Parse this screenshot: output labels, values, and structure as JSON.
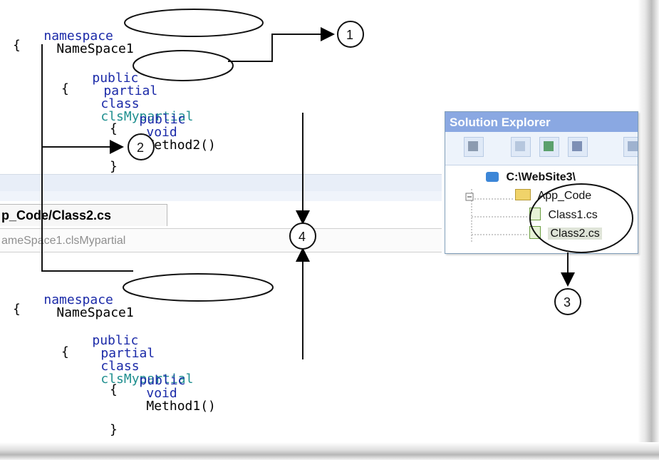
{
  "colors": {
    "keyword": "#1b2aa8",
    "class": "#1f8f8f",
    "text": "#000000",
    "ide_band": "#e8eef8",
    "panel_title": "#8aa8e2",
    "panel_border": "#7f9db9"
  },
  "code_top": {
    "line1": {
      "kw": "namespace",
      "name": "NameSpace1"
    },
    "brace_open": "{",
    "line3": {
      "kw1": "public",
      "kw2": "partial",
      "kw3": "class",
      "cls": "clsMypartial"
    },
    "brace_open2": "{",
    "line5": {
      "kw1": "public",
      "kw2": "void",
      "method": "Method2()"
    },
    "brace_open3": "{",
    "brace_close3": "}"
  },
  "tab": {
    "label": "p_Code/Class2.cs"
  },
  "nav": {
    "label": "ameSpace1.clsMypartial"
  },
  "code_bottom": {
    "line1": {
      "kw": "namespace",
      "name": "NameSpace1"
    },
    "brace_open": "{",
    "line3": {
      "kw1": "public",
      "kw2": "partial",
      "kw3": "class",
      "cls": "clsMypartial"
    },
    "brace_open2": "{",
    "line5": {
      "kw1": "public",
      "kw2": "void",
      "method": "Method1()"
    },
    "brace_open3": "{",
    "brace_close3": "}"
  },
  "solution_explorer": {
    "title": "Solution Explorer",
    "tree": [
      {
        "label": "C:\\WebSite3\\",
        "icon": "website-icon"
      },
      {
        "label": "App_Code",
        "icon": "folder-icon"
      },
      {
        "label": "Class1.cs",
        "icon": "csharp-file-icon"
      },
      {
        "label": "Class2.cs",
        "icon": "csharp-file-icon",
        "selected": true
      }
    ]
  },
  "annotations": {
    "one": "1",
    "two": "2",
    "three": "3",
    "four": "4"
  }
}
